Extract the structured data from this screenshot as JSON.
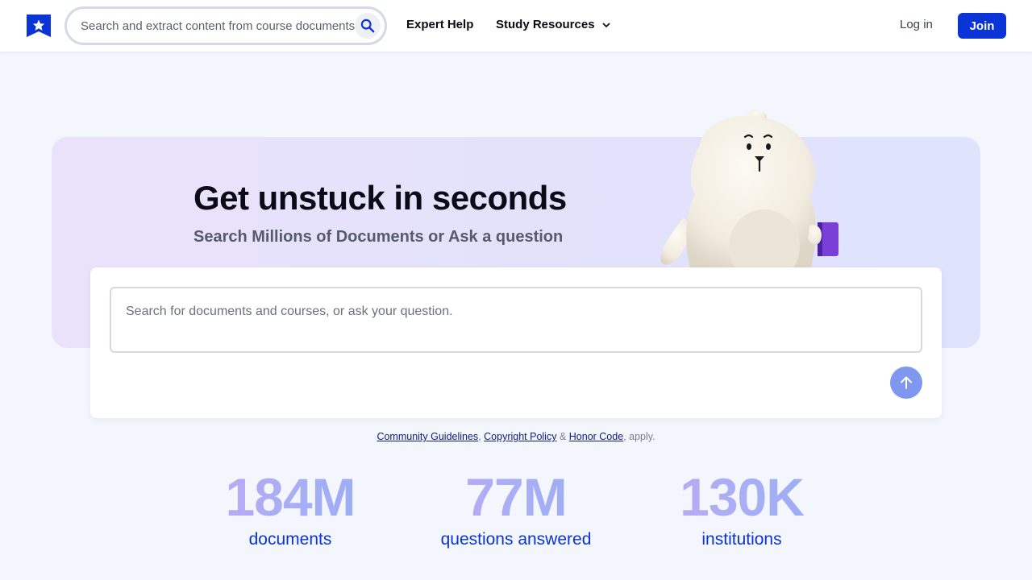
{
  "header": {
    "search_placeholder": "Search and extract content from course documents, ask a question",
    "nav_expert_help": "Expert Help",
    "nav_study_resources": "Study Resources",
    "login_label": "Log in",
    "join_label": "Join"
  },
  "hero": {
    "title": "Get unstuck in seconds",
    "subtitle": "Search Millions of Documents or Ask a question",
    "ask_placeholder": "Search for documents and courses, or ask your question."
  },
  "policy": {
    "community_guidelines": "Community Guidelines",
    "separator_comma": ", ",
    "copyright_policy": "Copyright Policy",
    "separator_amp": " & ",
    "honor_code": "Honor Code",
    "suffix": ", apply."
  },
  "stats": [
    {
      "value": "184M",
      "label": "documents"
    },
    {
      "value": "77M",
      "label": "questions answered"
    },
    {
      "value": "130K",
      "label": "institutions"
    }
  ],
  "icons": {
    "logo": "bookmark-star-icon",
    "search": "search-icon",
    "chevron": "chevron-down-icon",
    "submit": "arrow-up-icon"
  },
  "colors": {
    "brand": "#0a34d6",
    "page_bg": "#f3f6fd",
    "submit_button": "#7f97f0",
    "stat_gradient_start": "#c4a8f3",
    "stat_gradient_end": "#93abf6"
  }
}
